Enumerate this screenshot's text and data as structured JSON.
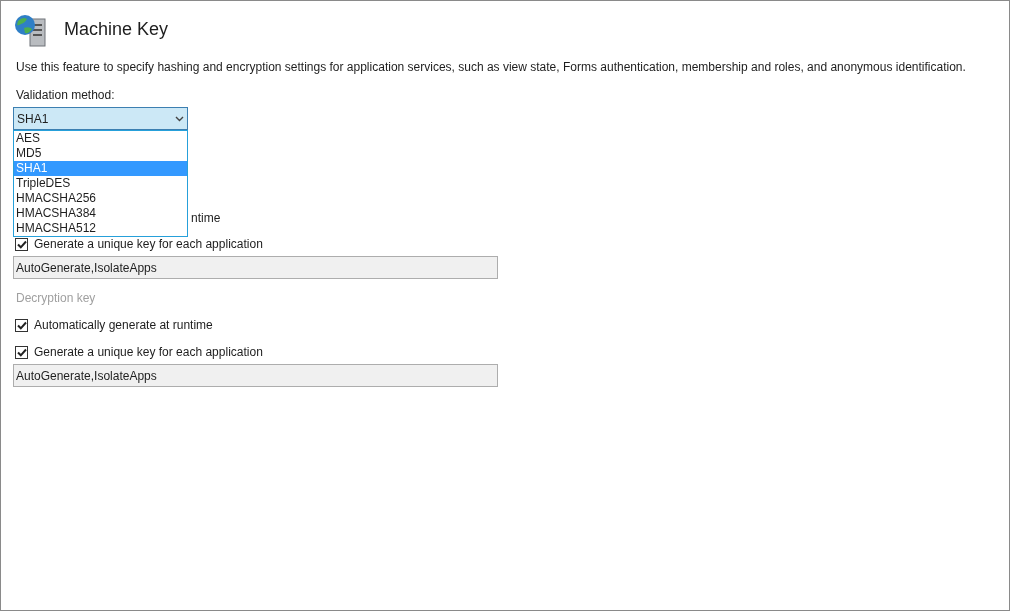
{
  "window": {
    "title": "Machine Key"
  },
  "description": "Use this feature to specify hashing and encryption settings for application services, such as view state, Forms authentication, membership and roles, and anonymous identification.",
  "validation_method": {
    "label": "Validation method:",
    "value": "SHA1",
    "expanded": true,
    "options": [
      {
        "label": "AES",
        "selected": false
      },
      {
        "label": "MD5",
        "selected": false
      },
      {
        "label": "SHA1",
        "selected": true
      },
      {
        "label": "TripleDES",
        "selected": false
      },
      {
        "label": "HMACSHA256",
        "selected": false
      },
      {
        "label": "HMACSHA384",
        "selected": false
      },
      {
        "label": "HMACSHA512",
        "selected": false
      }
    ]
  },
  "validation_key": {
    "auto_generate_fragment": "ntime",
    "unique_key": {
      "label": "Generate a unique key for each application",
      "checked": true
    },
    "value": "AutoGenerate,IsolateApps"
  },
  "decryption_key": {
    "label": "Decryption key",
    "disabled": true,
    "auto_generate": {
      "label": "Automatically generate at runtime",
      "checked": true
    },
    "unique_key": {
      "label": "Generate a unique key for each application",
      "checked": true
    },
    "value": "AutoGenerate,IsolateApps"
  }
}
